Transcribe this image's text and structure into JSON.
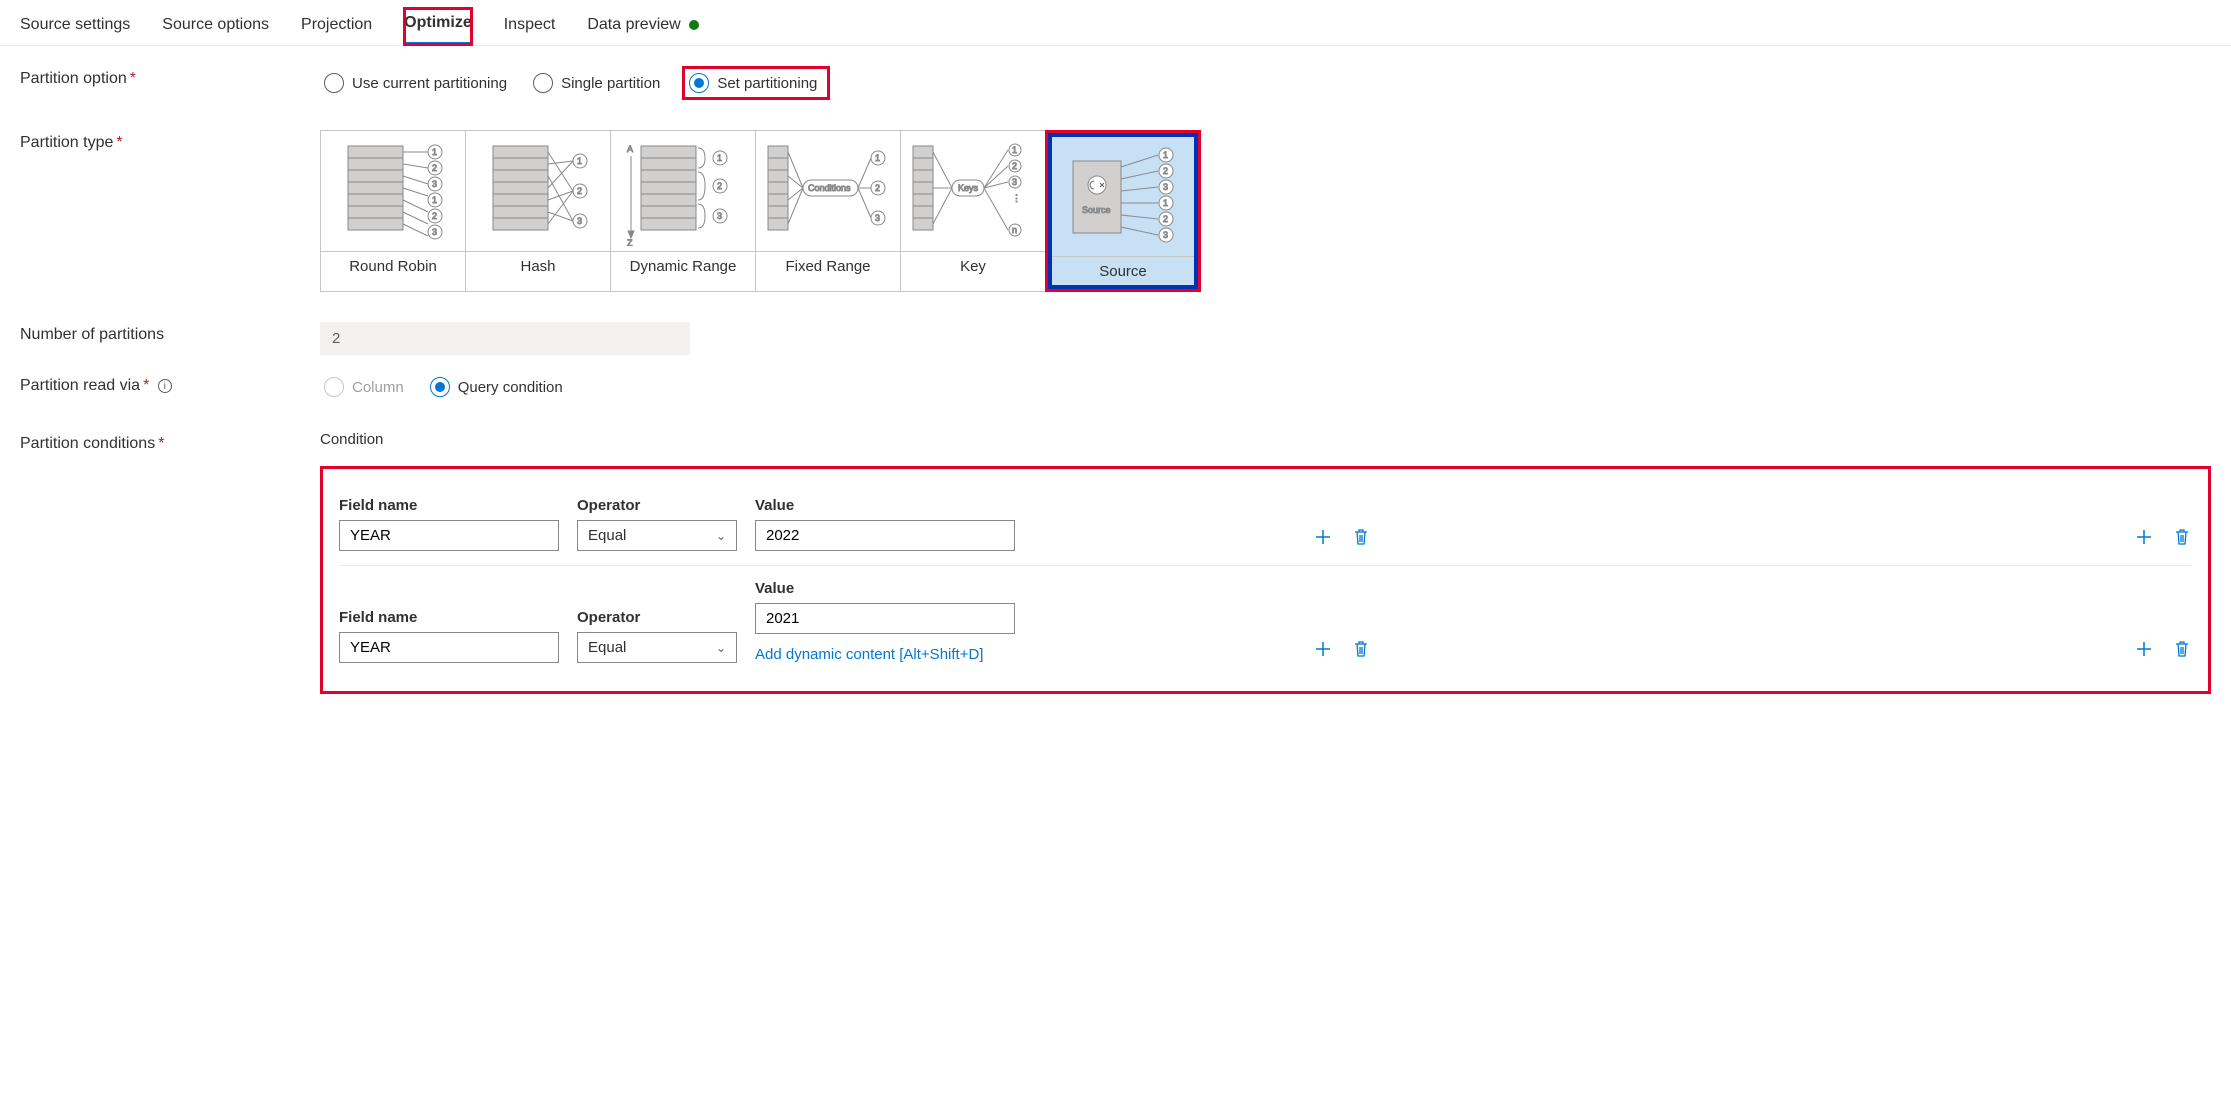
{
  "tabs": {
    "t0": "Source settings",
    "t1": "Source options",
    "t2": "Projection",
    "t3": "Optimize",
    "t4": "Inspect",
    "t5": "Data preview"
  },
  "labels": {
    "partition_option": "Partition option",
    "partition_type": "Partition type",
    "num_partitions": "Number of partitions",
    "partition_read_via": "Partition read via",
    "partition_conditions": "Partition conditions",
    "condition": "Condition",
    "field_name": "Field name",
    "operator": "Operator",
    "value": "Value"
  },
  "partition_option": {
    "o0": "Use current partitioning",
    "o1": "Single partition",
    "o2": "Set partitioning"
  },
  "partition_types": {
    "p0": "Round Robin",
    "p1": "Hash",
    "p2": "Dynamic Range",
    "p3": "Fixed Range",
    "p4": "Key",
    "p5": "Source"
  },
  "num_partitions_value": "2",
  "read_via": {
    "r0": "Column",
    "r1": "Query condition"
  },
  "conditions": [
    {
      "field": "YEAR",
      "op": "Equal",
      "val": "2022"
    },
    {
      "field": "YEAR",
      "op": "Equal",
      "val": "2021"
    }
  ],
  "dynamic_link": "Add dynamic content [Alt+Shift+D]",
  "diagram_text": {
    "conditions": "Conditions",
    "keys": "Keys",
    "source": "Source",
    "a": "A",
    "z": "Z",
    "n": "n"
  }
}
